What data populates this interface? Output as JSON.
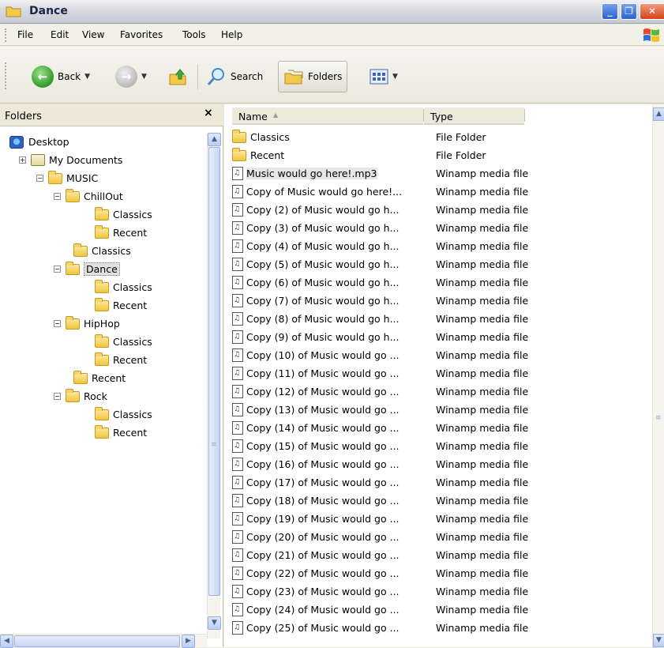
{
  "window": {
    "title": "Dance",
    "icon": "folder-icon"
  },
  "window_buttons": {
    "minimize": "_",
    "maximize": "❐",
    "close": "✕"
  },
  "menu": {
    "items": [
      "File",
      "Edit",
      "View",
      "Favorites",
      "Tools",
      "Help"
    ]
  },
  "toolbar": {
    "back_label": "Back",
    "search_label": "Search",
    "folders_label": "Folders"
  },
  "folders_panel": {
    "title": "Folders",
    "close": "×",
    "tree": [
      {
        "label": "Desktop",
        "icon": "desktop-icon",
        "expander": ""
      },
      {
        "label": "My Documents",
        "icon": "my-documents-icon",
        "expander": "+"
      },
      {
        "label": "MUSIC",
        "icon": "folder-icon",
        "expander": "−"
      },
      {
        "label": "ChillOut",
        "icon": "folder-icon",
        "expander": "−"
      },
      {
        "label": "Classics",
        "icon": "folder-icon",
        "expander": ""
      },
      {
        "label": "Recent",
        "icon": "folder-icon",
        "expander": ""
      },
      {
        "label": "Classics",
        "icon": "folder-icon",
        "expander": ""
      },
      {
        "label": "Dance",
        "icon": "folder-icon",
        "expander": "−",
        "selected": true
      },
      {
        "label": "Classics",
        "icon": "folder-icon",
        "expander": ""
      },
      {
        "label": "Recent",
        "icon": "folder-icon",
        "expander": ""
      },
      {
        "label": "HipHop",
        "icon": "folder-icon",
        "expander": "−"
      },
      {
        "label": "Classics",
        "icon": "folder-icon",
        "expander": ""
      },
      {
        "label": "Recent",
        "icon": "folder-icon",
        "expander": ""
      },
      {
        "label": "Recent",
        "icon": "folder-icon",
        "expander": ""
      },
      {
        "label": "Rock",
        "icon": "folder-icon",
        "expander": "−"
      },
      {
        "label": "Classics",
        "icon": "folder-icon",
        "expander": ""
      },
      {
        "label": "Recent",
        "icon": "folder-icon",
        "expander": ""
      }
    ]
  },
  "file_list": {
    "columns": {
      "name": "Name",
      "type": "Type"
    },
    "sort_indicator": "▲",
    "rows": [
      {
        "name": "Classics",
        "type": "File Folder",
        "icon": "folder-icon"
      },
      {
        "name": "Recent",
        "type": "File Folder",
        "icon": "folder-icon"
      },
      {
        "name": "Music would go here!.mp3",
        "type": "Winamp media file",
        "icon": "mp3-file-icon",
        "selected": true
      },
      {
        "name": "Copy of Music would go here!...",
        "type": "Winamp media file",
        "icon": "mp3-file-icon"
      },
      {
        "name": "Copy (2) of Music would go h...",
        "type": "Winamp media file",
        "icon": "mp3-file-icon"
      },
      {
        "name": "Copy (3) of Music would go h...",
        "type": "Winamp media file",
        "icon": "mp3-file-icon"
      },
      {
        "name": "Copy (4) of Music would go h...",
        "type": "Winamp media file",
        "icon": "mp3-file-icon"
      },
      {
        "name": "Copy (5) of Music would go h...",
        "type": "Winamp media file",
        "icon": "mp3-file-icon"
      },
      {
        "name": "Copy (6) of Music would go h...",
        "type": "Winamp media file",
        "icon": "mp3-file-icon"
      },
      {
        "name": "Copy (7) of Music would go h...",
        "type": "Winamp media file",
        "icon": "mp3-file-icon"
      },
      {
        "name": "Copy (8) of Music would go h...",
        "type": "Winamp media file",
        "icon": "mp3-file-icon"
      },
      {
        "name": "Copy (9) of Music would go h...",
        "type": "Winamp media file",
        "icon": "mp3-file-icon"
      },
      {
        "name": "Copy (10) of Music would go ...",
        "type": "Winamp media file",
        "icon": "mp3-file-icon"
      },
      {
        "name": "Copy (11) of Music would go ...",
        "type": "Winamp media file",
        "icon": "mp3-file-icon"
      },
      {
        "name": "Copy (12) of Music would go ...",
        "type": "Winamp media file",
        "icon": "mp3-file-icon"
      },
      {
        "name": "Copy (13) of Music would go ...",
        "type": "Winamp media file",
        "icon": "mp3-file-icon"
      },
      {
        "name": "Copy (14) of Music would go ...",
        "type": "Winamp media file",
        "icon": "mp3-file-icon"
      },
      {
        "name": "Copy (15) of Music would go ...",
        "type": "Winamp media file",
        "icon": "mp3-file-icon"
      },
      {
        "name": "Copy (16) of Music would go ...",
        "type": "Winamp media file",
        "icon": "mp3-file-icon"
      },
      {
        "name": "Copy (17) of Music would go ...",
        "type": "Winamp media file",
        "icon": "mp3-file-icon"
      },
      {
        "name": "Copy (18) of Music would go ...",
        "type": "Winamp media file",
        "icon": "mp3-file-icon"
      },
      {
        "name": "Copy (19) of Music would go ...",
        "type": "Winamp media file",
        "icon": "mp3-file-icon"
      },
      {
        "name": "Copy (20) of Music would go ...",
        "type": "Winamp media file",
        "icon": "mp3-file-icon"
      },
      {
        "name": "Copy (21) of Music would go ...",
        "type": "Winamp media file",
        "icon": "mp3-file-icon"
      },
      {
        "name": "Copy (22) of Music would go ...",
        "type": "Winamp media file",
        "icon": "mp3-file-icon"
      },
      {
        "name": "Copy (23) of Music would go ...",
        "type": "Winamp media file",
        "icon": "mp3-file-icon"
      },
      {
        "name": "Copy (24) of Music would go ...",
        "type": "Winamp media file",
        "icon": "mp3-file-icon"
      },
      {
        "name": "Copy (25) of Music would go ...",
        "type": "Winamp media file",
        "icon": "mp3-file-icon"
      }
    ]
  }
}
